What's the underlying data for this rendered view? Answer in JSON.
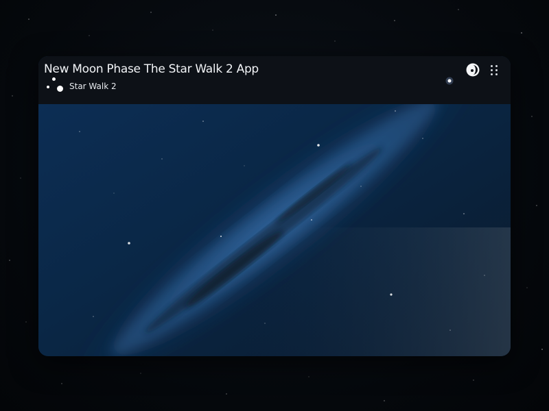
{
  "app": {
    "title": "New Moon Phase The Star Walk 2 App",
    "subtitle": "Star Walk 2"
  },
  "icons": {
    "logo": "star-walk-logo-icon",
    "moon": "moon-phase-icon",
    "menu": "grid-menu-icon"
  },
  "colors": {
    "background": "#05080d",
    "header": "#0d1117",
    "sky_top": "#0d2f57",
    "sky_band": "#2a5f99",
    "text": "#f2f4f7"
  }
}
